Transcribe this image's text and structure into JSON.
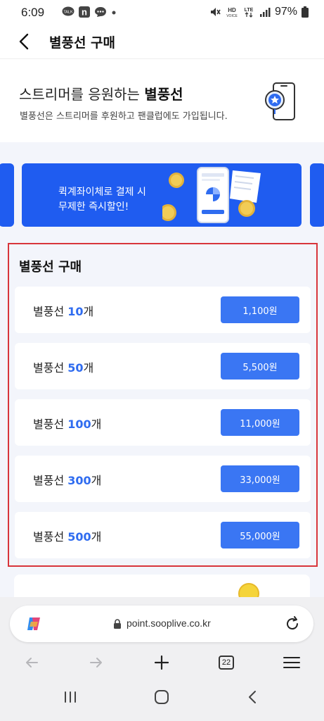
{
  "status_bar": {
    "time": "6:09",
    "battery": "97%",
    "icons": [
      "talk-icon",
      "naver-icon",
      "chat-icon",
      "dot-icon",
      "mute-icon",
      "hd-icon",
      "lte-icon",
      "signal-icon",
      "battery-icon"
    ]
  },
  "header": {
    "title": "별풍선 구매"
  },
  "hero": {
    "headline_prefix": "스트리머를 응원하는 ",
    "headline_bold": "별풍선",
    "subtitle": "별풍선은 스트리머를 후원하고 팬클럽에도 가입됩니다."
  },
  "banner": {
    "line1": "퀵계좌이체로 결제 시",
    "line2": "무제한 즉시할인!"
  },
  "purchase": {
    "title": "별풍선 구매",
    "items": [
      {
        "prefix": "별풍선 ",
        "count": "10",
        "suffix": "개",
        "price": "1,100원"
      },
      {
        "prefix": "별풍선 ",
        "count": "50",
        "suffix": "개",
        "price": "5,500원"
      },
      {
        "prefix": "별풍선 ",
        "count": "100",
        "suffix": "개",
        "price": "11,000원"
      },
      {
        "prefix": "별풍선 ",
        "count": "300",
        "suffix": "개",
        "price": "33,000원"
      },
      {
        "prefix": "별풍선 ",
        "count": "500",
        "suffix": "개",
        "price": "55,000원"
      }
    ]
  },
  "browser": {
    "url": "point.sooplive.co.kr",
    "tab_count": "22"
  },
  "colors": {
    "accent": "#3a76f3",
    "banner": "#1f5cf0",
    "highlight_border": "#d8353b",
    "count_text": "#2f6cf0"
  }
}
